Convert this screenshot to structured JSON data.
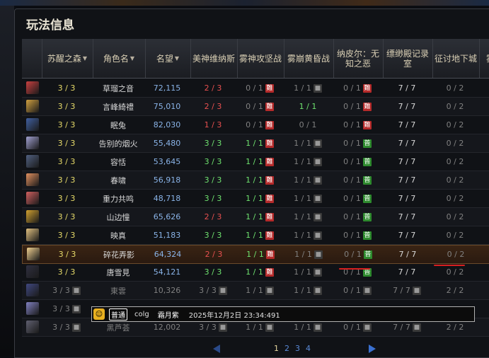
{
  "title": "玩法信息",
  "columns": [
    {
      "label": "苏醒之森",
      "sort": true
    },
    {
      "label": "角色名",
      "sort": true
    },
    {
      "label": "名望",
      "sort": true
    },
    {
      "label": "美神维纳斯"
    },
    {
      "label": "雾神攻坚战"
    },
    {
      "label": "雾崩黄昏战"
    },
    {
      "label": "纳皮尔：无知之恶"
    },
    {
      "label": "缥缈殿记录室"
    },
    {
      "label": "征讨地下城"
    },
    {
      "label": "雾"
    }
  ],
  "rows": [
    {
      "forest": "3 / 3",
      "name": "草瑠之音",
      "score": "72,115",
      "venus": "2 / 3",
      "venus_c": "red",
      "siege": "0 / 1",
      "siege_tag": "難",
      "siege_c": "gry",
      "dusk": "1 / 1",
      "dusk_c": "gry",
      "dusk_lock": true,
      "napier": "0 / 1",
      "napier_tag": "難",
      "mist": "7 / 7",
      "dungeon": "0 / 2",
      "dungeon_c": "gry",
      "av": "#c84040"
    },
    {
      "forest": "3 / 3",
      "name": "言峰綺禮",
      "score": "75,010",
      "venus": "2 / 3",
      "venus_c": "red",
      "siege": "0 / 1",
      "siege_tag": "難",
      "siege_c": "gry",
      "dusk": "1 / 1",
      "dusk_c": "grn",
      "dusk_lock": false,
      "napier": "0 / 1",
      "napier_tag": "難",
      "mist": "7 / 7",
      "dungeon": "0 / 2",
      "dungeon_c": "gry",
      "av": "#d0a040"
    },
    {
      "forest": "3 / 3",
      "name": "眠兔",
      "score": "82,030",
      "venus": "1 / 3",
      "venus_c": "red",
      "siege": "0 / 1",
      "siege_tag": "難",
      "siege_c": "gry",
      "dusk": "0 / 1",
      "dusk_c": "gry",
      "dusk_lock": false,
      "napier": "0 / 1",
      "napier_tag": "難",
      "mist": "7 / 7",
      "dungeon": "0 / 2",
      "dungeon_c": "gry",
      "av": "#4060a0"
    },
    {
      "forest": "3 / 3",
      "name": "告别的烟火",
      "score": "55,480",
      "venus": "3 / 3",
      "venus_c": "grn",
      "siege": "1 / 1",
      "siege_tag": "難",
      "siege_c": "grn",
      "dusk": "1 / 1",
      "dusk_c": "gry",
      "dusk_lock": true,
      "napier": "0 / 1",
      "napier_tag": "普",
      "mist": "7 / 7",
      "dungeon": "0 / 2",
      "dungeon_c": "gry",
      "av": "#a0a0d0"
    },
    {
      "forest": "3 / 3",
      "name": "容恬",
      "score": "53,645",
      "venus": "3 / 3",
      "venus_c": "grn",
      "siege": "1 / 1",
      "siege_tag": "難",
      "siege_c": "grn",
      "dusk": "1 / 1",
      "dusk_c": "gry",
      "dusk_lock": true,
      "napier": "0 / 1",
      "napier_tag": "普",
      "mist": "7 / 7",
      "dungeon": "0 / 2",
      "dungeon_c": "gry",
      "av": "#506080"
    },
    {
      "forest": "3 / 3",
      "name": "春啸",
      "score": "56,918",
      "venus": "3 / 3",
      "venus_c": "grn",
      "siege": "1 / 1",
      "siege_tag": "難",
      "siege_c": "grn",
      "dusk": "1 / 1",
      "dusk_c": "gry",
      "dusk_lock": true,
      "napier": "0 / 1",
      "napier_tag": "普",
      "mist": "7 / 7",
      "dungeon": "0 / 2",
      "dungeon_c": "gry",
      "av": "#e09060"
    },
    {
      "forest": "3 / 3",
      "name": "重力共鸣",
      "score": "48,718",
      "venus": "3 / 3",
      "venus_c": "grn",
      "siege": "1 / 1",
      "siege_tag": "難",
      "siege_c": "grn",
      "dusk": "1 / 1",
      "dusk_c": "gry",
      "dusk_lock": true,
      "napier": "0 / 1",
      "napier_tag": "普",
      "mist": "7 / 7",
      "dungeon": "0 / 2",
      "dungeon_c": "gry",
      "av": "#d06060"
    },
    {
      "forest": "3 / 3",
      "name": "山边憧",
      "score": "65,626",
      "venus": "2 / 3",
      "venus_c": "red",
      "siege": "1 / 1",
      "siege_tag": "難",
      "siege_c": "grn",
      "dusk": "1 / 1",
      "dusk_c": "gry",
      "dusk_lock": true,
      "napier": "0 / 1",
      "napier_tag": "普",
      "mist": "7 / 7",
      "dungeon": "0 / 2",
      "dungeon_c": "gry",
      "av": "#d0a030"
    },
    {
      "forest": "3 / 3",
      "name": "映真",
      "score": "51,183",
      "venus": "3 / 3",
      "venus_c": "grn",
      "siege": "1 / 1",
      "siege_tag": "難",
      "siege_c": "grn",
      "dusk": "1 / 1",
      "dusk_c": "gry",
      "dusk_lock": true,
      "napier": "0 / 1",
      "napier_tag": "普",
      "mist": "7 / 7",
      "dungeon": "0 / 2",
      "dungeon_c": "gry",
      "av": "#e0c080"
    },
    {
      "forest": "3 / 3",
      "name": "碎花弄影",
      "score": "64,324",
      "venus": "2 / 3",
      "venus_c": "red",
      "siege": "1 / 1",
      "siege_tag": "難",
      "siege_c": "grn",
      "dusk": "1 / 1",
      "dusk_c": "gry",
      "dusk_lock": true,
      "napier": "0 / 1",
      "napier_tag": "普",
      "mist": "7 / 7",
      "dungeon": "0 / 2",
      "dungeon_c": "gry",
      "av": "#f0d090",
      "hl": true
    },
    {
      "forest": "3 / 3",
      "name": "唐雪見",
      "score": "54,121",
      "venus": "3 / 3",
      "venus_c": "grn",
      "siege": "1 / 1",
      "siege_tag": "難",
      "siege_c": "grn",
      "dusk": "1 / 1",
      "dusk_c": "gry",
      "dusk_lock": true,
      "napier": "0 / 1",
      "napier_tag": "普",
      "mist": "7 / 7",
      "dungeon": "0 / 2",
      "dungeon_c": "gry",
      "av": "#303040"
    },
    {
      "forest": "3 / 3",
      "name": "東雲",
      "score": "10,326",
      "venus": "3 / 3",
      "venus_c": "gry",
      "siege": "1 / 1",
      "siege_tag": "",
      "siege_c": "gry",
      "dusk": "1 / 1",
      "dusk_c": "gry",
      "dusk_lock": true,
      "napier": "0 / 1",
      "napier_tag": "",
      "mist": "7 / 7",
      "dungeon": "2 / 2",
      "dungeon_c": "gry",
      "av": "#404880",
      "dim": true
    },
    {
      "forest": "3 / 3",
      "name": "",
      "score": "",
      "venus": "",
      "venus_c": "gry",
      "siege": "",
      "siege_tag": "",
      "siege_c": "gry",
      "dusk": "",
      "dusk_c": "gry",
      "dusk_lock": false,
      "napier": "",
      "napier_tag": "",
      "mist": "",
      "dungeon": "",
      "dungeon_c": "gry",
      "av": "#8080c0",
      "dim": true
    },
    {
      "forest": "3 / 3",
      "name": "黑芦荟",
      "score": "12,002",
      "venus": "3 / 3",
      "venus_c": "gry",
      "siege": "1 / 1",
      "siege_tag": "",
      "siege_c": "gry",
      "dusk": "1 / 1",
      "dusk_c": "gry",
      "dusk_lock": true,
      "napier": "0 / 1",
      "napier_tag": "",
      "mist": "7 / 7",
      "dungeon": "2 / 2",
      "dungeon_c": "gry",
      "av": "#606070",
      "dim": true
    }
  ],
  "tooltip": {
    "channel": "普通",
    "user": "colg",
    "name": "霜月紫",
    "time": "2025年12月2日 23:34:491"
  },
  "pager": {
    "pages": [
      "1",
      "2",
      "3",
      "4"
    ],
    "current": "1"
  }
}
